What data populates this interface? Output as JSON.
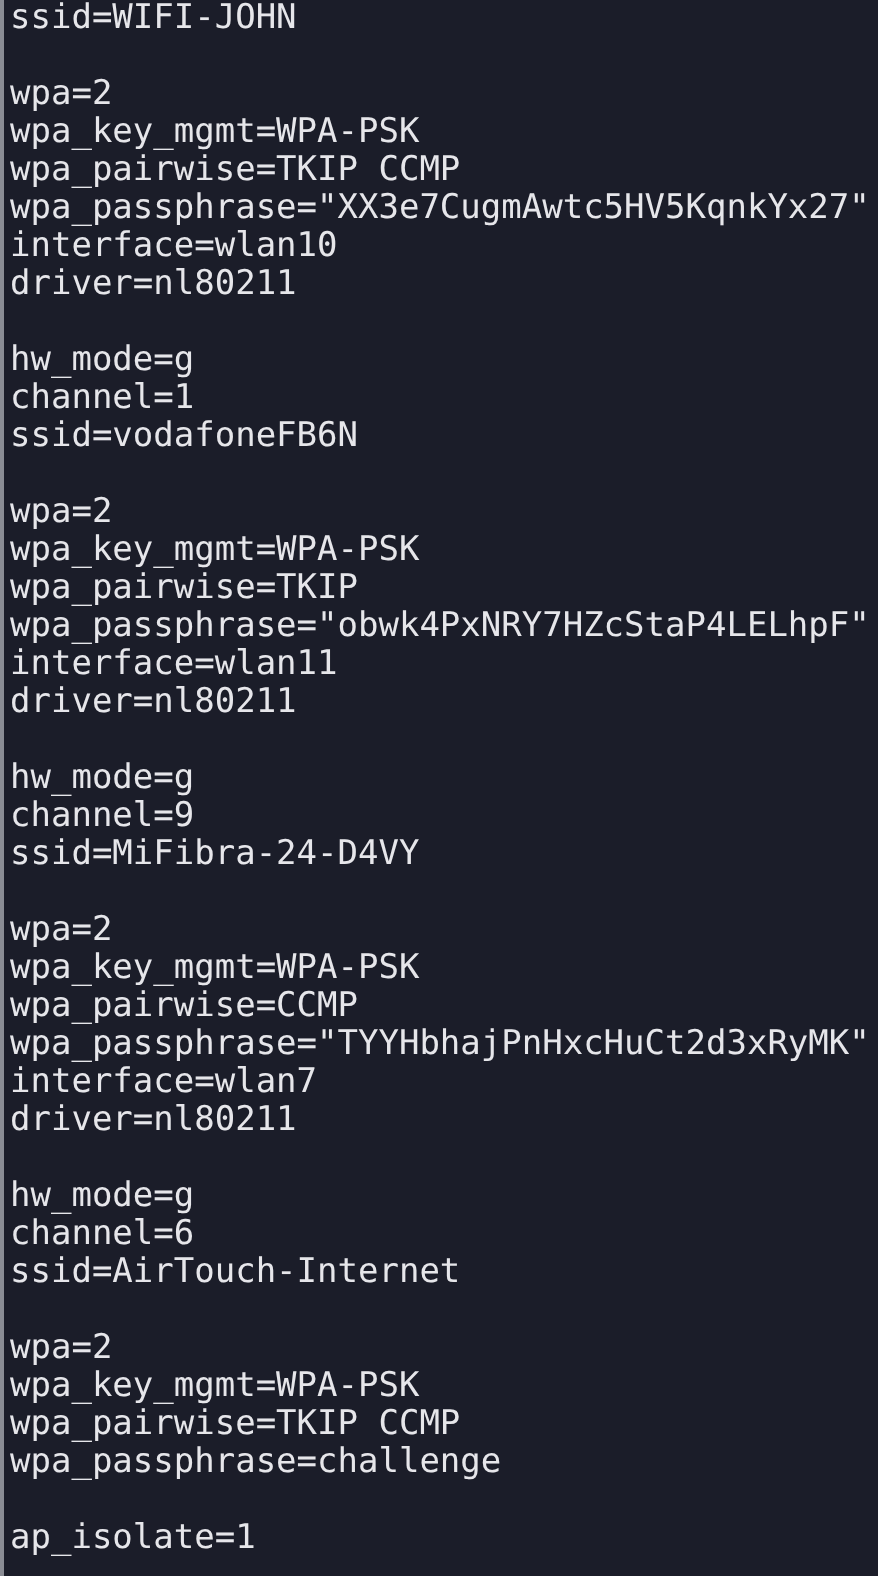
{
  "terminal": {
    "blocks": [
      [
        "ssid=WIFI-JOHN"
      ],
      [
        "wpa=2",
        "wpa_key_mgmt=WPA-PSK",
        "wpa_pairwise=TKIP CCMP",
        "wpa_passphrase=\"XX3e7CugmAwtc5HV5KqnkYx27\"",
        "interface=wlan10",
        "driver=nl80211"
      ],
      [
        "hw_mode=g",
        "channel=1",
        "ssid=vodafoneFB6N"
      ],
      [
        "wpa=2",
        "wpa_key_mgmt=WPA-PSK",
        "wpa_pairwise=TKIP",
        "wpa_passphrase=\"obwk4PxNRY7HZcStaP4LELhpF\"",
        "interface=wlan11",
        "driver=nl80211"
      ],
      [
        "hw_mode=g",
        "channel=9",
        "ssid=MiFibra-24-D4VY"
      ],
      [
        "wpa=2",
        "wpa_key_mgmt=WPA-PSK",
        "wpa_pairwise=CCMP",
        "wpa_passphrase=\"TYYHbhajPnHxcHuCt2d3xRyMK\"",
        "interface=wlan7",
        "driver=nl80211"
      ],
      [
        "hw_mode=g",
        "channel=6",
        "ssid=AirTouch-Internet"
      ],
      [
        "wpa=2",
        "wpa_key_mgmt=WPA-PSK",
        "wpa_pairwise=TKIP CCMP",
        "wpa_passphrase=challenge"
      ],
      [
        "ap_isolate=1"
      ]
    ]
  }
}
